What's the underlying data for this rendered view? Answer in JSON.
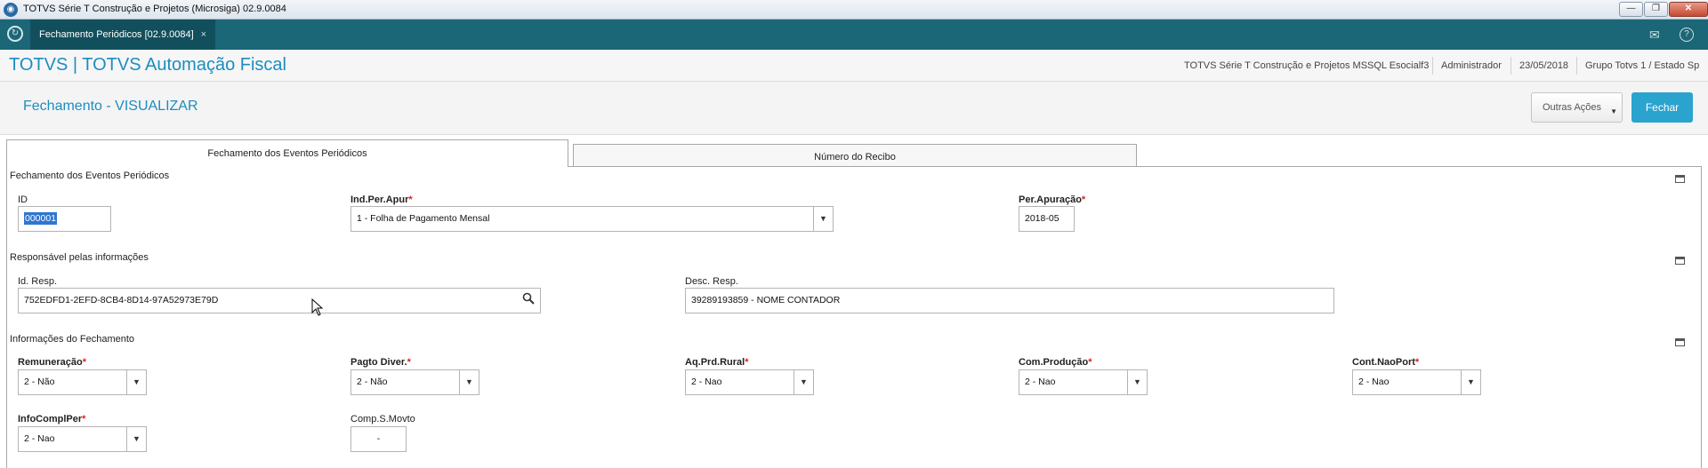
{
  "window": {
    "title": "TOTVS Série T Construção e Projetos (Microsiga) 02.9.0084",
    "minimize": "—",
    "restore": "❐",
    "close": "✕"
  },
  "tabstrip": {
    "tab_label": "Fechamento Periódicos [02.9.0084]",
    "tab_close": "×",
    "mail_icon": "✉",
    "help_icon": "?"
  },
  "header": {
    "brand": "TOTVS | TOTVS Automação Fiscal",
    "environment": "TOTVS Série T Construção e Projetos MSSQL Esocialf3",
    "user": "Administrador",
    "date": "23/05/2018",
    "company": "Grupo Totvs 1 / Estado Sp"
  },
  "page": {
    "title": "Fechamento - VISUALIZAR",
    "other_actions": "Outras Ações",
    "close_button": "Fechar"
  },
  "folders": {
    "tab1": "Fechamento dos Eventos Periódicos",
    "tab2": "Número do Recibo"
  },
  "sections": {
    "events": {
      "title": "Fechamento dos Eventos Periódicos",
      "id_label": "ID",
      "id_value": "000001",
      "indper_label": "Ind.Per.Apur",
      "indper_value": "1 - Folha de Pagamento Mensal",
      "perapur_label": "Per.Apuração",
      "perapur_value": "2018-05"
    },
    "responsible": {
      "title": "Responsável pelas informações",
      "idresp_label": "Id. Resp.",
      "idresp_value": "752EDFD1-2EFD-8CB4-8D14-97A52973E79D",
      "descresp_label": "Desc. Resp.",
      "descresp_value": "39289193859 - NOME CONTADOR"
    },
    "closing": {
      "title": "Informações do Fechamento",
      "remuneracao_label": "Remuneração",
      "remuneracao_value": "2 - Não",
      "pagto_label": "Pagto Diver.",
      "pagto_value": "2 - Não",
      "aqprd_label": "Aq.Prd.Rural",
      "aqprd_value": "2 - Nao",
      "comprod_label": "Com.Produção",
      "comprod_value": "2 - Nao",
      "contnao_label": "Cont.NaoPort",
      "contnao_value": "2 - Nao",
      "infocompl_label": "InfoComplPer",
      "infocompl_value": "2 - Nao",
      "compsmovto_label": "Comp.S.Movto",
      "compsmovto_value": "-"
    }
  },
  "required_mark": "*",
  "icons": {
    "dropdown": "▼",
    "search": "search-icon",
    "collapse": "collapse-icon"
  }
}
